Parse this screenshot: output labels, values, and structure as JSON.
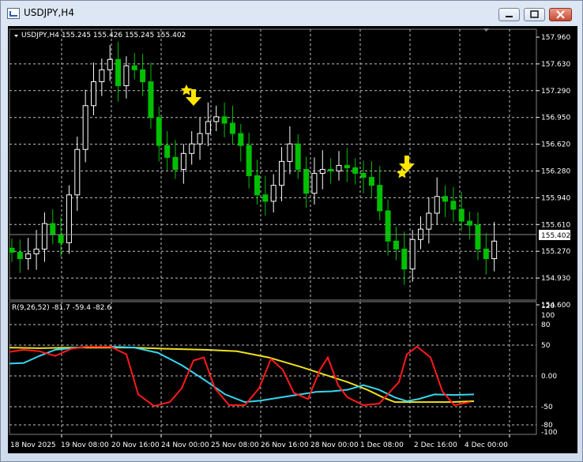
{
  "window": {
    "title": "USDJPY,H4"
  },
  "main_chart": {
    "header": "USDJPY,H4  155.245 155.426 155.245 155.402",
    "price_labels": [
      "157.960",
      "157.630",
      "157.290",
      "156.950",
      "156.620",
      "156.280",
      "155.940",
      "155.610",
      "155.270",
      "154.930",
      "154.600"
    ],
    "current_price": "155.402"
  },
  "indicator": {
    "header": "R(9,26,52) -81.7 -59.4 -82.6",
    "labels": [
      "120",
      "100",
      "80",
      "50",
      "0.00",
      "-50",
      "-80",
      "-100"
    ]
  },
  "time_axis": [
    "18 Nov 2025",
    "19 Nov 08:00",
    "20 Nov 16:00",
    "24 Nov 00:00",
    "25 Nov 08:00",
    "26 Nov 16:00",
    "28 Nov 00:00",
    "1 Dec 08:00",
    "2 Dec 16:00",
    "4 Dec 00:00"
  ],
  "colors": {
    "bull": "#ffffff",
    "bear": "#00c000",
    "grid": "#c0c0c0",
    "line_red": "#ff1a1a",
    "line_cyan": "#35d7f0",
    "line_yellow": "#f0e020",
    "arrow": "#ffe600"
  },
  "chart_data": {
    "type": "candlestick",
    "ylim": [
      154.6,
      158.1
    ],
    "close": [
      155.26,
      155.18,
      155.24,
      155.3,
      155.62,
      155.48,
      155.38,
      155.98,
      156.55,
      157.1,
      157.4,
      157.55,
      157.68,
      157.35,
      157.6,
      157.55,
      157.4,
      156.95,
      156.6,
      156.45,
      156.3,
      156.5,
      156.62,
      156.75,
      156.9,
      156.96,
      156.88,
      156.75,
      156.6,
      156.22,
      155.98,
      155.9,
      156.1,
      156.4,
      156.62,
      156.3,
      156.0,
      156.25,
      156.3,
      156.28,
      156.35,
      156.32,
      156.25,
      156.2,
      156.1,
      155.78,
      155.4,
      155.3,
      155.05,
      155.42,
      155.55,
      155.75,
      155.96,
      155.9,
      155.8,
      155.65,
      155.6,
      155.3,
      155.18,
      155.4
    ]
  }
}
